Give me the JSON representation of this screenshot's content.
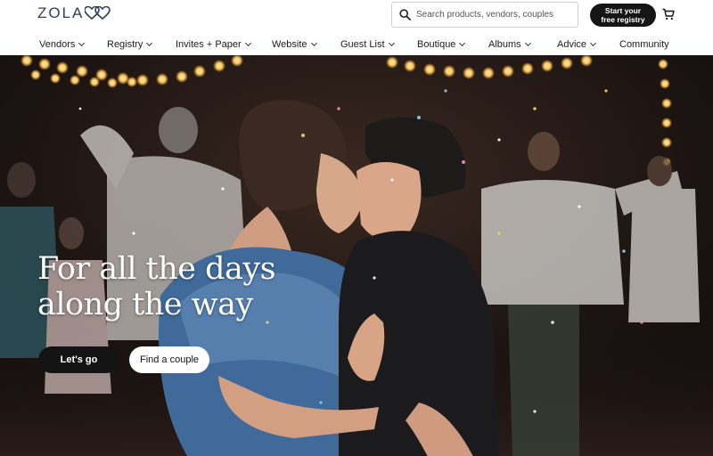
{
  "header": {
    "logo_text": "ZOLA",
    "search": {
      "placeholder": "Search products, vendors, couples"
    },
    "registry_button": {
      "line1": "Start your",
      "line2": "free registry"
    },
    "icons": {
      "search": "search-icon",
      "cart": "cart-icon",
      "logo": "double-heart-icon"
    },
    "colors": {
      "logo": "#2c3e5a",
      "button_bg": "#151515"
    }
  },
  "nav": {
    "items": [
      {
        "label": "Vendors",
        "has_dropdown": true
      },
      {
        "label": "Registry",
        "has_dropdown": true
      },
      {
        "label": "Invites + Paper",
        "has_dropdown": true
      },
      {
        "label": "Website",
        "has_dropdown": true
      },
      {
        "label": "Guest List",
        "has_dropdown": true
      },
      {
        "label": "Boutique",
        "has_dropdown": true
      },
      {
        "label": "Albums",
        "has_dropdown": true
      },
      {
        "label": "Advice",
        "has_dropdown": true
      },
      {
        "label": "Community",
        "has_dropdown": false
      }
    ]
  },
  "hero": {
    "title_line1": "For all the days",
    "title_line2": "along the way",
    "primary_button": "Let's go",
    "secondary_button": "Find a couple"
  }
}
